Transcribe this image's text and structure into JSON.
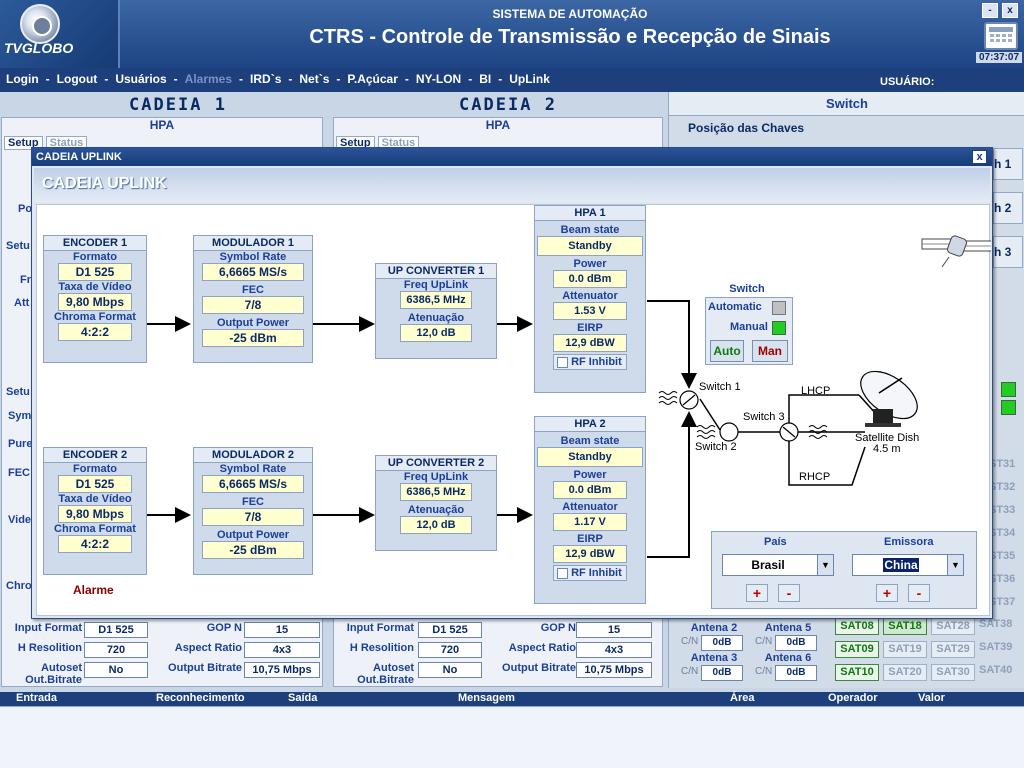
{
  "header": {
    "logo_text": "TVGLOBO",
    "system_label": "SISTEMA DE AUTOMAÇÃO",
    "title": "CTRS - Controle de Transmissão e Recepção de Sinais",
    "minimize": "-",
    "close": "x",
    "clock": "07:37:07"
  },
  "nav": {
    "items": [
      "Login",
      "Logout",
      "Usuários",
      "Alarmes",
      "IRD`s",
      "Net`s",
      "P.Açúcar",
      "NY-LON",
      "BI",
      "UpLink"
    ],
    "user_label": "USUÁRIO:"
  },
  "background": {
    "cadeia1": "CADEIA 1",
    "cadeia2": "CADEIA 2",
    "hpa": "HPA",
    "tab_setup": "Setup",
    "tab_status": "Status",
    "switch_title": "Switch",
    "posicao": "Posição das Chaves",
    "side_labels": [
      "Po",
      "Setu",
      "Fr",
      "Att",
      "Setu",
      "Sym",
      "Pure",
      "FEC",
      "Vide",
      "Chro"
    ],
    "h1": "h 1",
    "h2": "h 2",
    "h3": "h 3",
    "rows": [
      {
        "left_label": "Input Format",
        "left_val": "D1 525",
        "right_label": "GOP N",
        "right_val": "15"
      },
      {
        "left_label": "H Resolition",
        "left_val": "720",
        "right_label": "Aspect Ratio",
        "right_val": "4x3"
      },
      {
        "left_label": "Autoset Out.Bitrate",
        "left_val": "No",
        "right_label": "Output Bitrate",
        "right_val": "10,75 Mbps"
      }
    ],
    "antenas": [
      {
        "name": "Antena 2",
        "cn": "C/N",
        "val": "0dB"
      },
      {
        "name": "Antena 5",
        "cn": "C/N",
        "val": "0dB"
      },
      {
        "name": "Antena 3",
        "cn": "C/N",
        "val": "0dB"
      },
      {
        "name": "Antena 6",
        "cn": "C/N",
        "val": "0dB"
      }
    ],
    "sat_rows": [
      [
        "SAT08",
        "SAT18",
        "SAT28",
        "SAT38"
      ],
      [
        "SAT09",
        "SAT19",
        "SAT29",
        "SAT39"
      ],
      [
        "SAT10",
        "SAT20",
        "SAT30",
        "SAT40"
      ]
    ],
    "sat_right": [
      "ST31",
      "ST32",
      "ST33",
      "ST34",
      "ST35",
      "ST36",
      "ST37"
    ],
    "bottom_cols": [
      "Entrada",
      "Reconhecimento",
      "Saída",
      "Mensagem",
      "Área",
      "Operador",
      "Valor"
    ]
  },
  "modal": {
    "titlebar": "CADEIA UPLINK",
    "heading": "CADEIA UPLINK",
    "close": "x",
    "encoders": [
      {
        "title": "ENCODER 1",
        "formato_lbl": "Formato",
        "formato": "D1 525",
        "taxa_lbl": "Taxa de Vídeo",
        "taxa": "9,80 Mbps",
        "chroma_lbl": "Chroma Format",
        "chroma": "4:2:2"
      },
      {
        "title": "ENCODER 2",
        "formato_lbl": "Formato",
        "formato": "D1 525",
        "taxa_lbl": "Taxa de Vídeo",
        "taxa": "9,80 Mbps",
        "chroma_lbl": "Chroma Format",
        "chroma": "4:2:2"
      }
    ],
    "alarm": "Alarme",
    "modulators": [
      {
        "title": "MODULADOR 1",
        "sr_lbl": "Symbol Rate",
        "sr": "6,6665 MS/s",
        "fec_lbl": "FEC",
        "fec": "7/8",
        "op_lbl": "Output Power",
        "op": "-25 dBm"
      },
      {
        "title": "MODULADOR 2",
        "sr_lbl": "Symbol Rate",
        "sr": "6,6665 MS/s",
        "fec_lbl": "FEC",
        "fec": "7/8",
        "op_lbl": "Output Power",
        "op": "-25 dBm"
      }
    ],
    "upconverters": [
      {
        "title": "UP CONVERTER 1",
        "freq_lbl": "Freq UpLink",
        "freq": "6386,5 MHz",
        "at_lbl": "Atenuação",
        "at": "12,0 dB"
      },
      {
        "title": "UP CONVERTER 2",
        "freq_lbl": "Freq UpLink",
        "freq": "6386,5 MHz",
        "at_lbl": "Atenuação",
        "at": "12,0 dB"
      }
    ],
    "hpas": [
      {
        "title": "HPA 1",
        "beam_lbl": "Beam state",
        "beam": "Standby",
        "pw_lbl": "Power",
        "pw": "0.0 dBm",
        "att_lbl": "Attenuator",
        "att": "1.53 V",
        "eirp_lbl": "EIRP",
        "eirp": "12,9 dBW",
        "rf": "RF Inhibit"
      },
      {
        "title": "HPA 2",
        "beam_lbl": "Beam state",
        "beam": "Standby",
        "pw_lbl": "Power",
        "pw": "0.0 dBm",
        "att_lbl": "Attenuator",
        "att": "1.17 V",
        "eirp_lbl": "EIRP",
        "eirp": "12,9 dBW",
        "rf": "RF Inhibit"
      }
    ],
    "switch": {
      "title": "Switch",
      "automatic": "Automatic",
      "manual": "Manual",
      "auto_btn": "Auto",
      "man_btn": "Man",
      "s1": "Switch 1",
      "s2": "Switch 2",
      "s3": "Switch 3",
      "lhcp": "LHCP",
      "rhcp": "RHCP",
      "dish": "Satellite Dish",
      "dish_size": "4.5 m",
      "colors": {
        "manual_on": "#22cc22",
        "auto_off": "#c0c0c0"
      }
    },
    "pais": {
      "label": "País",
      "value": "Brasil",
      "plus": "+",
      "minus": "-"
    },
    "emissora": {
      "label": "Emissora",
      "value": "China",
      "plus": "+",
      "minus": "-"
    }
  }
}
